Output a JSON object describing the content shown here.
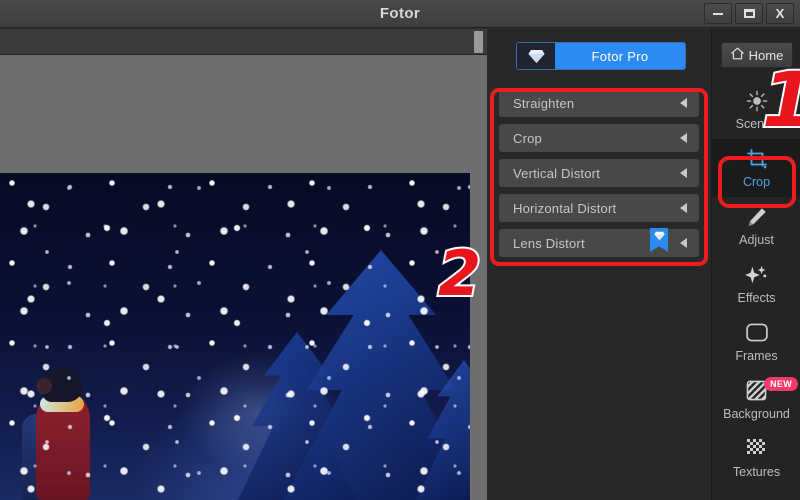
{
  "window": {
    "title": "Fotor",
    "controls": [
      {
        "name": "minimize",
        "glyph": "minimize-icon"
      },
      {
        "name": "maximize",
        "glyph": "maximize-icon"
      },
      {
        "name": "close",
        "glyph": "close-icon",
        "label": "X"
      }
    ]
  },
  "canvas": {
    "image_description": "Winter night illustration: girl in red coat with scarf looking up at falling snow beside blue pine trees",
    "background_color": "#6e6e6e",
    "scrollbar": "vertical-scroll-handle"
  },
  "tool_panel": {
    "pro_button": {
      "label": "Fotor Pro",
      "icon": "diamond-icon",
      "accent_color": "#2b8bf0"
    },
    "rows": [
      {
        "label": "Straighten",
        "arrow": "chevron-left-icon",
        "pro": false
      },
      {
        "label": "Crop",
        "arrow": "chevron-left-icon",
        "pro": false
      },
      {
        "label": "Vertical Distort",
        "arrow": "chevron-left-icon",
        "pro": false
      },
      {
        "label": "Horizontal Distort",
        "arrow": "chevron-left-icon",
        "pro": false
      },
      {
        "label": "Lens Distort",
        "arrow": "chevron-left-icon",
        "pro": true,
        "badge_icon": "diamond-badge-icon"
      }
    ]
  },
  "annotations": {
    "color": "#ee1b20",
    "outline_color": "#ffffff",
    "number_one": "1",
    "number_two": "2",
    "highlight_target": "Crop"
  },
  "sidebar": {
    "home": {
      "label": "Home",
      "icon": "home-icon"
    },
    "items": [
      {
        "label": "Scenes",
        "icon": "scenes-sun-icon",
        "active": false,
        "badge": ""
      },
      {
        "label": "Crop",
        "icon": "crop-icon",
        "active": true,
        "badge": ""
      },
      {
        "label": "Adjust",
        "icon": "pencil-icon",
        "active": false,
        "badge": ""
      },
      {
        "label": "Effects",
        "icon": "sparkles-icon",
        "active": false,
        "badge": ""
      },
      {
        "label": "Frames",
        "icon": "rounded-square-icon",
        "active": false,
        "badge": ""
      },
      {
        "label": "Background",
        "icon": "hatched-square-icon",
        "active": false,
        "badge": "NEW"
      },
      {
        "label": "Textures",
        "icon": "checker-dots-icon",
        "active": false,
        "badge": ""
      }
    ],
    "active_color": "#4aa3e8",
    "badge_color": "#f4396e"
  }
}
